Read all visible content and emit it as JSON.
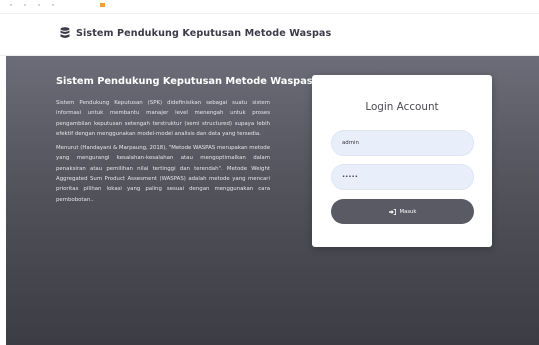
{
  "header": {
    "brand_icon": "database-icon",
    "brand_title": "Sistem Pendukung Keputusan Metode Waspas"
  },
  "intro": {
    "title": "Sistem Pendukung Keputusan Metode Waspas",
    "paragraph1": "Sistem Pendukung Keputusan (SPK) didefinisikan sebagai suatu sistem informasi untuk membantu manajer level menengah untuk proses pengambilan keputusan setengah terstruktur (semi structured) supaya lebih efektif dengan menggunakan model-model analisis dan data yang tersedia.",
    "paragraph2": "Menurut (Handayani & Marpaung, 2018), \"Metode WASPAS merupakan metode yang mengurangi kesalahan-kesalahan atau mengoptimalkan dalam penaksiran atau pemilihan nilai tertinggi dan terendah\". Metode Weight Aggregated Sum Product Assesment (WASPAS) adalah metode yang mencari prioritas pilihan lokasi yang paling sesuai dengan menggunakan cara pembobotan.."
  },
  "login": {
    "title": "Login Account",
    "username_value": "admin",
    "password_value": "•••••",
    "button_label": "Masuk",
    "button_icon": "sign-in-icon"
  },
  "colors": {
    "hero_top": "#6d6d79",
    "hero_bottom": "#3c3c44",
    "input_bg": "#e9eefb",
    "button_bg": "#5a5a64",
    "accent": "#f39c3a"
  }
}
